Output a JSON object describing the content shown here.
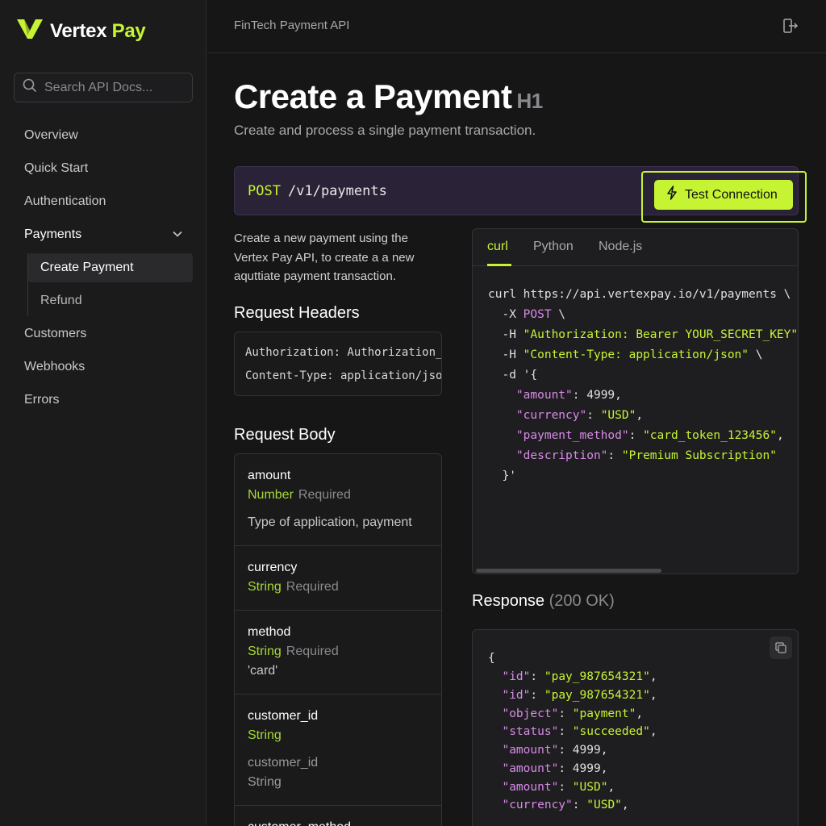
{
  "brand": {
    "name_part1": "Vertex",
    "name_part2": "Pay"
  },
  "search": {
    "placeholder": "Search API Docs..."
  },
  "sidebar": {
    "items": [
      {
        "label": "Overview"
      },
      {
        "label": "Quick Start"
      },
      {
        "label": "Authentication"
      },
      {
        "label": "Payments"
      },
      {
        "label": "Customers"
      },
      {
        "label": "Webhooks"
      },
      {
        "label": "Errors"
      }
    ],
    "payments_children": [
      {
        "label": "Create Payment",
        "active": true
      },
      {
        "label": "Refund",
        "active": false
      }
    ]
  },
  "topbar": {
    "title": "FinTech Payment API"
  },
  "page": {
    "title": "Create a Payment",
    "title_tag": "H1",
    "subtitle": "Create and process a single payment transaction."
  },
  "endpoint": {
    "method": "POST",
    "path": "/v1/payments",
    "test_button": "Test Connection"
  },
  "description": {
    "line1": "Create a new payment using the",
    "line2": "Vertex Pay API, to create a a new",
    "line3": "aquttiate payment transaction."
  },
  "request_headers": {
    "title": "Request Headers",
    "line1": "Authorization: Authorization_KEY",
    "line2": "Content-Type: application/json"
  },
  "request_body": {
    "title": "Request Body",
    "fields": [
      {
        "name": "amount",
        "type": "Number",
        "required": "Required",
        "extra": "Type of application, payment"
      },
      {
        "name": "currency",
        "type": "String",
        "required": "Required"
      },
      {
        "name": "method",
        "type": "String",
        "required": "Required",
        "extra": "'card'"
      },
      {
        "name": "customer_id",
        "type": "String",
        "extra": "customer_id",
        "extra2": "String"
      },
      {
        "name": "customer_method"
      }
    ]
  },
  "code_tabs": [
    {
      "label": "curl",
      "active": true
    },
    {
      "label": "Python",
      "active": false
    },
    {
      "label": "Node.js",
      "active": false
    }
  ],
  "code": {
    "l1": "curl https://api.vertexpay.io/v1/payments \\",
    "l2_flag": "  -X ",
    "l2_val": "POST",
    "l2_tail": " \\",
    "l3_flag": "  -H ",
    "l3_val": "\"Authorization: Bearer YOUR_SECRET_KEY\"",
    "l3_tail": " \\",
    "l4_flag": "  -H ",
    "l4_val": "\"Content-Type: application/json\"",
    "l4_tail": " \\",
    "l5": "  -d '{",
    "l6_key": "\"amount\"",
    "l6_val": "4999",
    "l7_key": "\"currency\"",
    "l7_val": "\"USD\"",
    "l8_key": "\"payment_method\"",
    "l8_val": "\"card_token_123456\"",
    "l9_key": "\"description\"",
    "l9_val": "\"Premium Subscription\"",
    "l10": "  }'"
  },
  "response": {
    "title": "Response",
    "status": "(200 OK)",
    "open": "{",
    "lines": [
      {
        "key": "\"id\"",
        "val": "\"pay_987654321\"",
        "kind": "string"
      },
      {
        "key": "\"id\"",
        "val": "\"pay_987654321\"",
        "kind": "string"
      },
      {
        "key": "\"object\"",
        "val": "\"payment\"",
        "kind": "string"
      },
      {
        "key": "\"status\"",
        "val": "\"succeeded\"",
        "kind": "string"
      },
      {
        "key": "\"amount\"",
        "val": "4999",
        "kind": "number"
      },
      {
        "key": "\"amount\"",
        "val": "4999",
        "kind": "number"
      },
      {
        "key": "\"amount\"",
        "val": "\"USD\"",
        "kind": "string"
      },
      {
        "key": "\"currency\"",
        "val": "\"USD\"",
        "kind": "string"
      }
    ]
  },
  "colors": {
    "accent": "#c6f432",
    "key": "#d88ae8",
    "endpoint_bg": "#2a2236"
  },
  "icons": [
    "vertex-logo-icon",
    "search-icon",
    "chevron-down-icon",
    "logout-icon",
    "bolt-icon",
    "copy-icon"
  ]
}
